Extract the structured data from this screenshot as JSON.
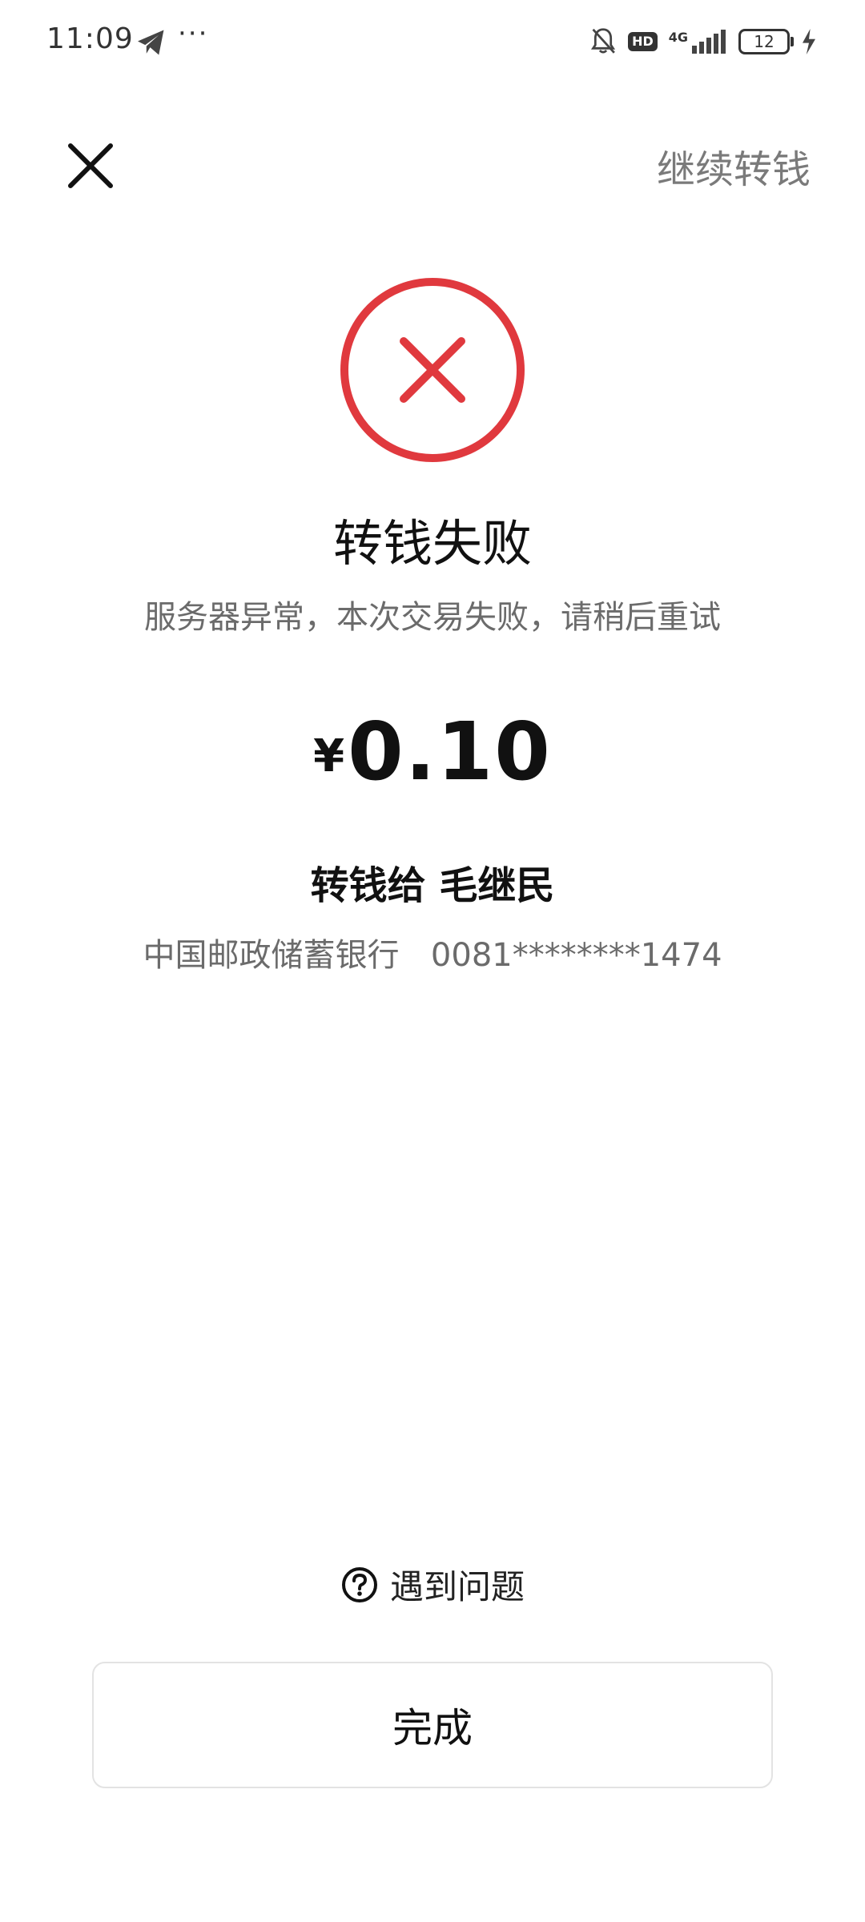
{
  "status_bar": {
    "time": "11:09",
    "network": "4G",
    "hd": "HD",
    "battery": "12"
  },
  "nav": {
    "continue_label": "继续转钱"
  },
  "result": {
    "title": "转钱失败",
    "message": "服务器异常，本次交易失败，请稍后重试"
  },
  "amount": {
    "currency": "¥",
    "value": "0.10"
  },
  "recipient": {
    "label": "转钱给 毛继民",
    "bank": "中国邮政储蓄银行",
    "account": "0081********1474"
  },
  "help": {
    "label": "遇到问题"
  },
  "done_button": {
    "label": "完成"
  },
  "colors": {
    "error": "#e0393e",
    "muted_text": "#6b6b6b"
  },
  "icons": {
    "close": "close-icon",
    "fail": "error-x-circle-icon",
    "help": "question-circle-icon"
  }
}
